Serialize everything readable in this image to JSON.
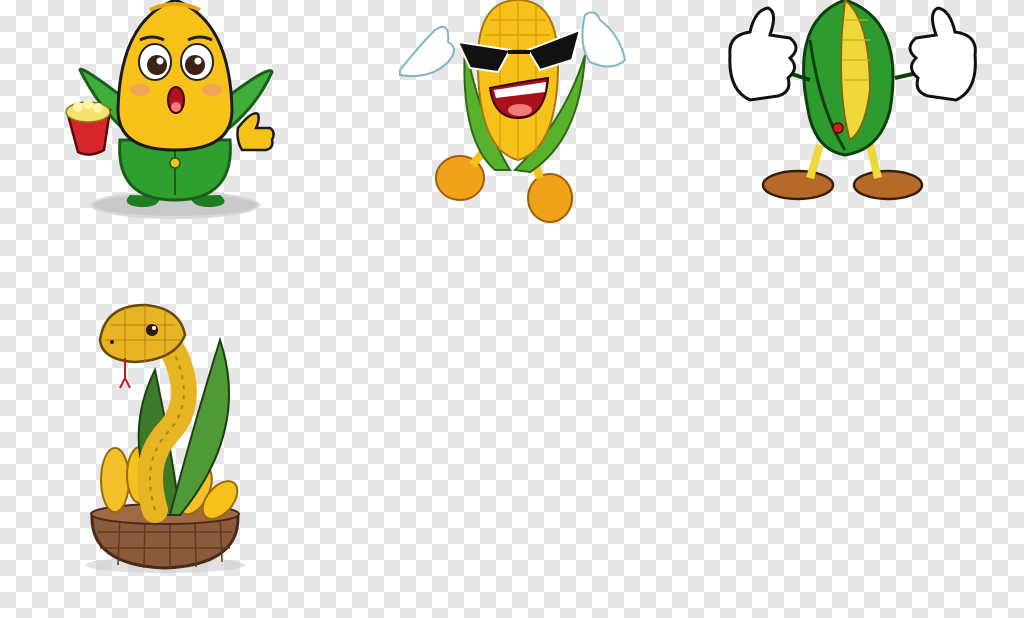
{
  "image": {
    "background": "transparency-checkerboard",
    "checker_colors": [
      "#ffffff",
      "#e6e6e6"
    ],
    "subjects": [
      {
        "name": "corn-mascot-popcorn",
        "holds": "popcorn-cup",
        "palette": [
          "#f6c21a",
          "#2d9a2f",
          "#e0262c"
        ]
      },
      {
        "name": "corn-mascot-sunglasses",
        "palette": [
          "#f6c21a",
          "#58b12c",
          "#111111"
        ]
      },
      {
        "name": "corn-mascot-thumbs-up",
        "palette": [
          "#f0d83a",
          "#2e9b2e",
          "#b56a2a"
        ]
      },
      {
        "name": "corn-snake-in-basket",
        "palette": [
          "#e7b524",
          "#3c7a2a",
          "#8a5a3a"
        ]
      }
    ]
  }
}
